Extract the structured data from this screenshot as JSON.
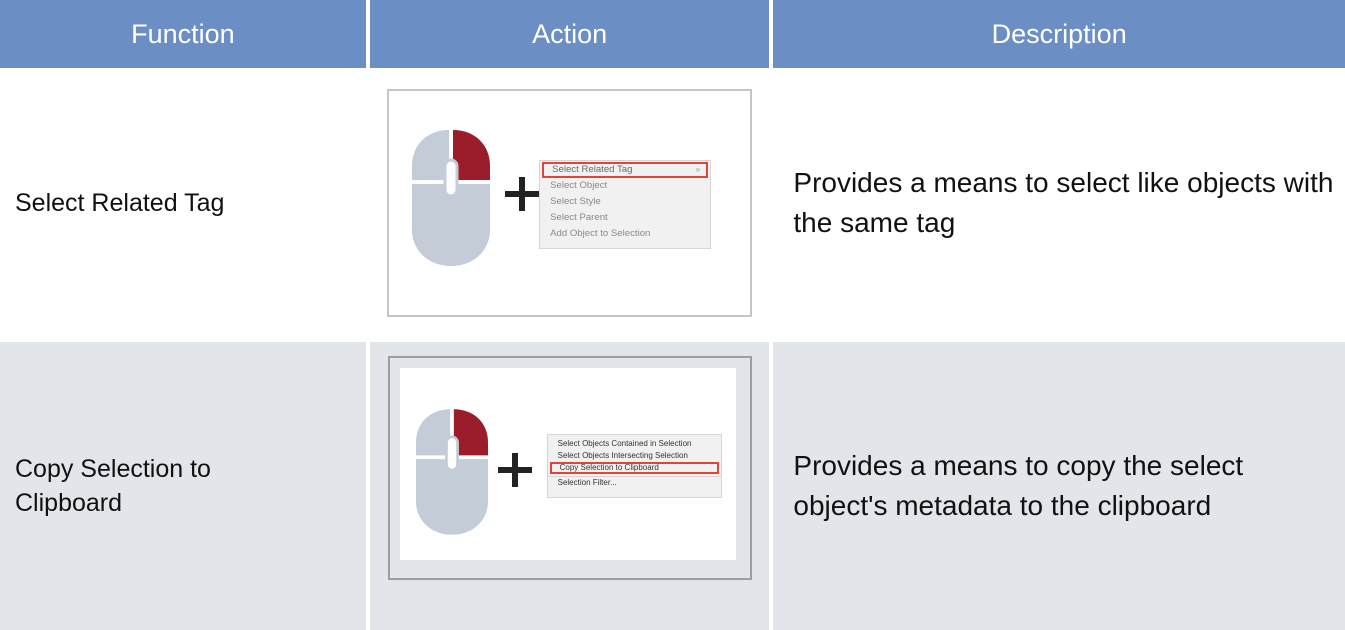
{
  "header": {
    "function": "Function",
    "action": "Action",
    "description": "Description"
  },
  "rows": [
    {
      "function": "Select Related Tag",
      "description": "Provides a means to select like objects with the same tag",
      "menu": {
        "items": [
          "Select Related Tag",
          "Select Object",
          "Select Style",
          "Select Parent",
          "Add Object to Selection"
        ],
        "highlighted_index": 0,
        "submenu_arrow": "»"
      }
    },
    {
      "function": "Copy Selection to Clipboard",
      "description": "Provides a means to copy the select object's metadata to the clipboard",
      "menu": {
        "items": [
          "Select Objects Contained in Selection",
          "Select Objects Intersecting Selection",
          "Copy Selection to Clipboard",
          "Selection Filter..."
        ],
        "highlighted_index": 2
      }
    }
  ],
  "icons": {
    "mouse": "mouse-right-click-icon",
    "plus": "plus-icon"
  },
  "colors": {
    "header_bg": "#6b8ec4",
    "alt_row_bg": "#e2e6ea",
    "mouse_button_highlight": "#9b1c2a",
    "mouse_body": "#c3ccd7",
    "menu_highlight_border": "#e0443b"
  }
}
